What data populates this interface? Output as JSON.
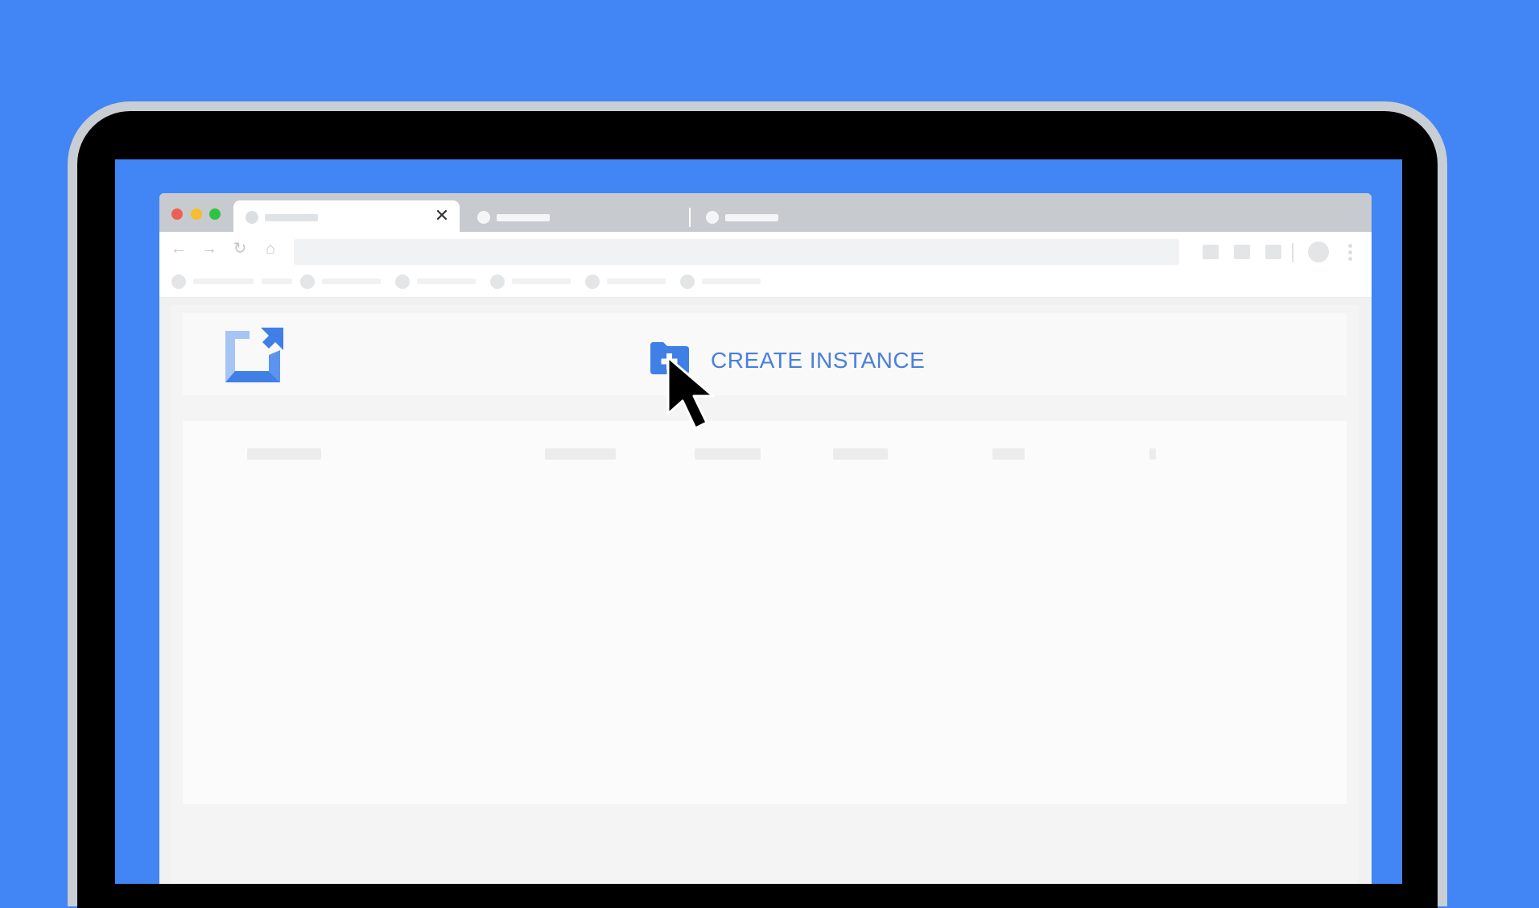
{
  "browser": {
    "window_controls": [
      "close",
      "minimize",
      "maximize"
    ],
    "tabs": [
      {
        "state": "active",
        "close_icon": "✕"
      },
      {
        "state": "inactive"
      },
      {
        "state": "inactive"
      }
    ],
    "toolbar": {
      "back_icon": "←",
      "forward_icon": "→",
      "reload_icon": "↻",
      "home_icon": "⌂"
    }
  },
  "app": {
    "logo": "compute-instance-logo",
    "create_button": {
      "icon": "folder-plus-icon",
      "label": "CREATE INSTANCE"
    }
  },
  "colors": {
    "background": "#4285f4",
    "accent": "#4a7fdc",
    "laptop_frame": "#c9ced4",
    "bezel": "#000000",
    "tab_strip": "#c7cbcf"
  },
  "cursor": "arrow-pointer-icon"
}
